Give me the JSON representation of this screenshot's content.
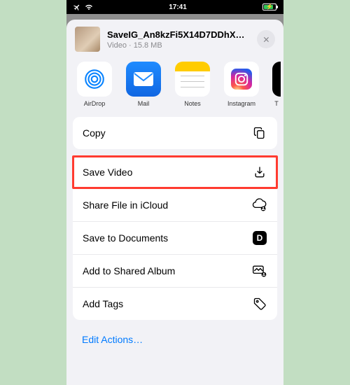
{
  "status": {
    "time": "17:41"
  },
  "file": {
    "title": "SaveIG_An8kzFi5X14D7DDhXM...",
    "type": "Video",
    "size": "15.8 MB",
    "separator": " · "
  },
  "apps": {
    "airdrop": "AirDrop",
    "mail": "Mail",
    "notes": "Notes",
    "instagram": "Instagram",
    "partial": "T"
  },
  "actions": {
    "copy": "Copy",
    "saveVideo": "Save Video",
    "shareIcloud": "Share File in iCloud",
    "saveDocuments": "Save to Documents",
    "addSharedAlbum": "Add to Shared Album",
    "addTags": "Add Tags"
  },
  "editActions": "Edit Actions…"
}
